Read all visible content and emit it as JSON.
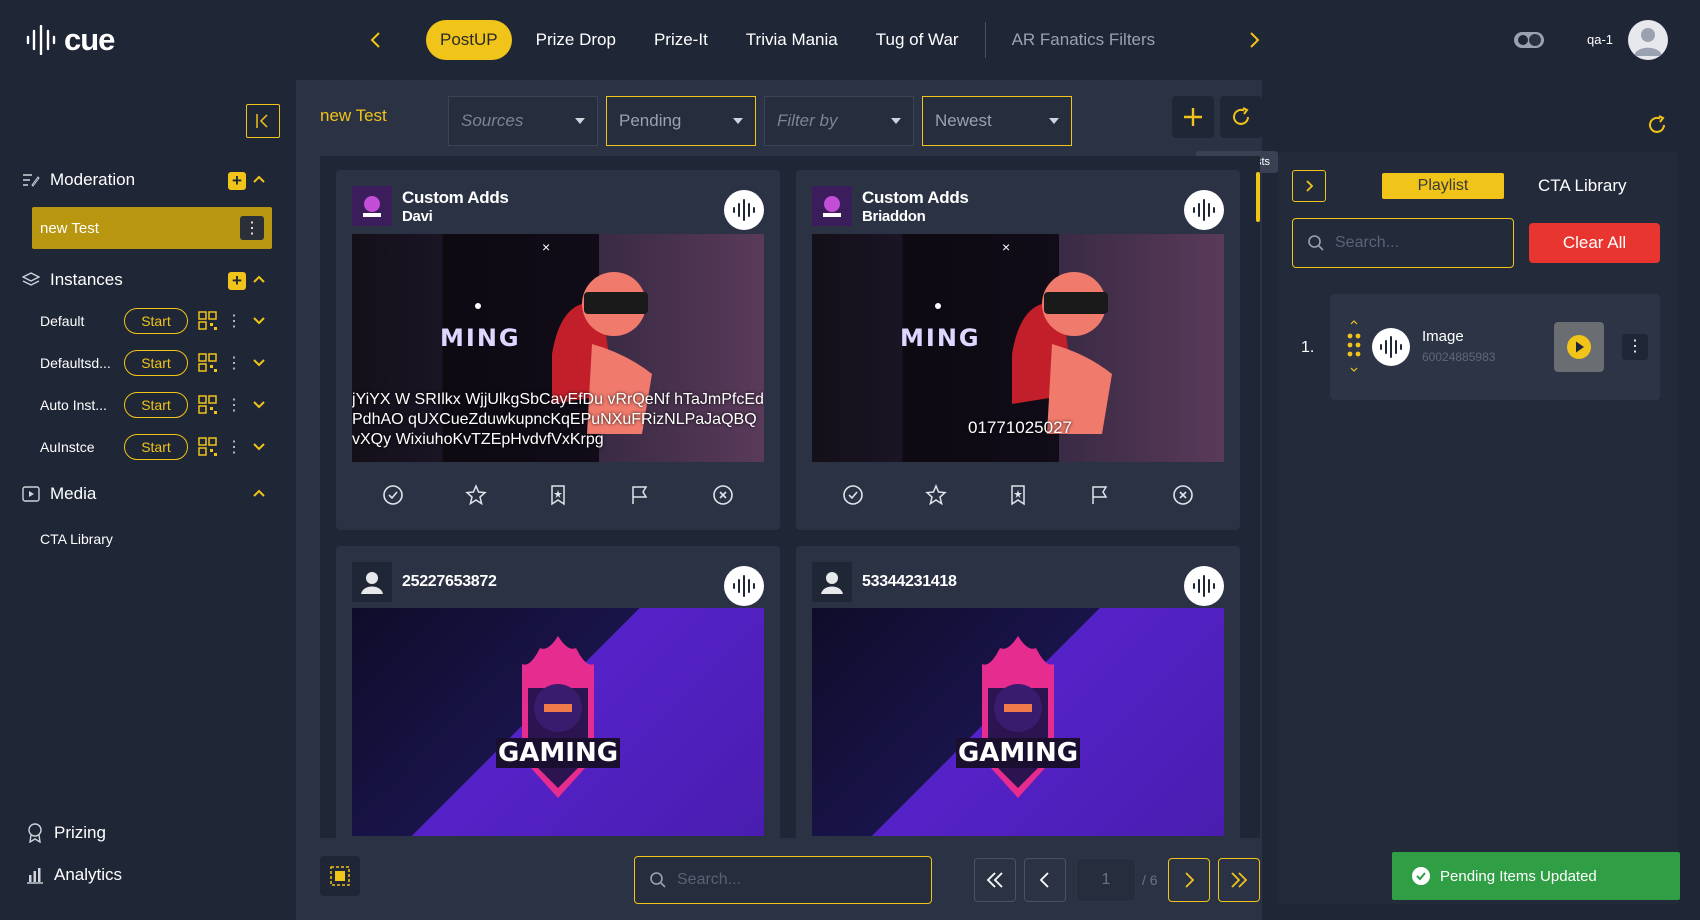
{
  "app": {
    "logo_text": "cue",
    "user_name": "qa-1"
  },
  "nav": {
    "tabs": [
      {
        "label": "PostUP",
        "active": true
      },
      {
        "label": "Prize Drop"
      },
      {
        "label": "Prize-It"
      },
      {
        "label": "Trivia Mania"
      },
      {
        "label": "Tug of War"
      },
      {
        "label": "AR Fanatics Filters",
        "dimmed": true
      }
    ]
  },
  "sidebar": {
    "moderation": {
      "label": "Moderation",
      "items": [
        {
          "label": "new Test",
          "selected": true
        }
      ]
    },
    "instances": {
      "label": "Instances",
      "items": [
        {
          "name": "Default",
          "start_label": "Start"
        },
        {
          "name": "Defaultsd...",
          "start_label": "Start"
        },
        {
          "name": "Auto Inst...",
          "start_label": "Start"
        },
        {
          "name": "AuInstce",
          "start_label": "Start"
        }
      ]
    },
    "media": {
      "label": "Media",
      "items": [
        {
          "label": "CTA Library"
        }
      ]
    },
    "bottom": {
      "prizing": "Prizing",
      "analytics": "Analytics"
    }
  },
  "main": {
    "instance_title": "new Test",
    "filters": {
      "sources": {
        "placeholder": "Sources"
      },
      "status": {
        "value": "Pending"
      },
      "filter_by": {
        "placeholder": "Filter by"
      },
      "sort": {
        "value": "Newest"
      }
    },
    "tooltip": "Update Posts",
    "cards": [
      {
        "title": "Custom Adds",
        "subtitle": "Davi",
        "overlay_text": "jYiYX W SRIlkx WjjUlkgSbCayEfDu vRrQeNf hTaJmPfcEdPdhAO qUXCueZduwkupncKqEPuNXuFRizNLPaJaQBQvXQy WixiuhoKvTZEpHvdvfVxKrpg"
      },
      {
        "title": "Custom Adds",
        "subtitle": "Briaddon",
        "overlay_text": "01771025027"
      },
      {
        "title": "25227653872"
      },
      {
        "title": "53344231418"
      }
    ],
    "search": {
      "placeholder": "Search..."
    },
    "pagination": {
      "current": "1",
      "total_label": "/ 6"
    }
  },
  "right_panel": {
    "tabs": {
      "playlist": "Playlist",
      "cta_library": "CTA Library"
    },
    "search": {
      "placeholder": "Search..."
    },
    "clear_all": "Clear All",
    "playlist": [
      {
        "index": "1.",
        "name": "Image",
        "id": "60024885983"
      }
    ]
  },
  "toast": {
    "message": "Pending Items Updated"
  },
  "colors": {
    "accent": "#f0c419",
    "danger": "#e8352f",
    "success": "#2f9e44",
    "bg": "#1f2636"
  }
}
